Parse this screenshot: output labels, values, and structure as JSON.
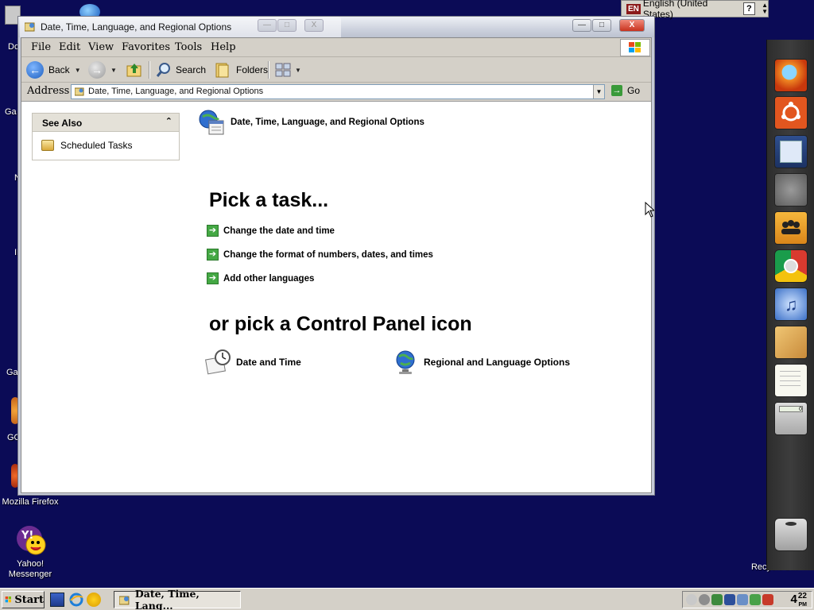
{
  "desktop": {
    "icons": [
      {
        "label": "Mozilla Firefox"
      },
      {
        "label": "Yahoo!\nMessenger"
      },
      {
        "label": "Recycle Bin"
      }
    ],
    "partial_labels": [
      "Do",
      "Ga",
      "N",
      "IE",
      "Ga",
      "GO"
    ]
  },
  "language_bar": {
    "code": "EN",
    "language": "English (United States)",
    "help": "?"
  },
  "dock": {
    "items": [
      "firefox-icon",
      "ubuntu-icon",
      "text-editor-icon",
      "gears-icon",
      "users-icon",
      "chrome-icon",
      "itunes-icon",
      "paint-icon",
      "notepad-icon",
      "calculator-icon",
      "trash-icon"
    ]
  },
  "window": {
    "title": "Date, Time, Language, and Regional Options",
    "controls": {
      "minimize": "—",
      "maximize": "□",
      "close": "X"
    },
    "menu": [
      "File",
      "Edit",
      "View",
      "Favorites",
      "Tools",
      "Help"
    ],
    "toolbar": {
      "back": "Back",
      "search": "Search",
      "folders": "Folders"
    },
    "address": {
      "label": "Address",
      "value": "Date, Time, Language, and Regional Options",
      "go": "Go"
    },
    "see_also": {
      "header": "See Also",
      "items": [
        "Scheduled Tasks"
      ]
    },
    "category_title": "Date, Time, Language, and Regional Options",
    "pick_task_heading": "Pick a task...",
    "tasks": [
      "Change the date and time",
      "Change the format of numbers, dates, and times",
      "Add other languages"
    ],
    "pick_icon_heading": "or pick a Control Panel icon",
    "cp_icons": [
      "Date and Time",
      "Regional and Language Options"
    ]
  },
  "taskbar": {
    "start": "Start",
    "task_button": "Date, Time, Lang...",
    "clock": {
      "hour": "4",
      "minute": "22",
      "ampm": "PM"
    }
  }
}
